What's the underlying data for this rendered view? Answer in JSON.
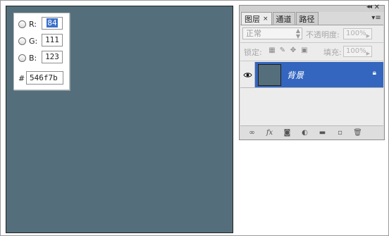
{
  "picker": {
    "r": {
      "label": "R:",
      "value": "84"
    },
    "g": {
      "label": "G:",
      "value": "111"
    },
    "b": {
      "label": "B:",
      "value": "123"
    },
    "hash": "#",
    "hex": "546f7b"
  },
  "canvas": {
    "color": "#546f7b"
  },
  "layers_panel": {
    "tabs": [
      {
        "label": "图层",
        "close": "×"
      },
      {
        "label": "通道"
      },
      {
        "label": "路径"
      }
    ],
    "collapse": "◂◂",
    "close": "✕",
    "menu": "▾≡",
    "blend_mode": "正常",
    "opacity_label": "不透明度:",
    "opacity_value": "100%",
    "lock_label": "锁定:",
    "fill_label": "填充:",
    "fill_value": "100%",
    "layer": {
      "name": "背景"
    }
  }
}
